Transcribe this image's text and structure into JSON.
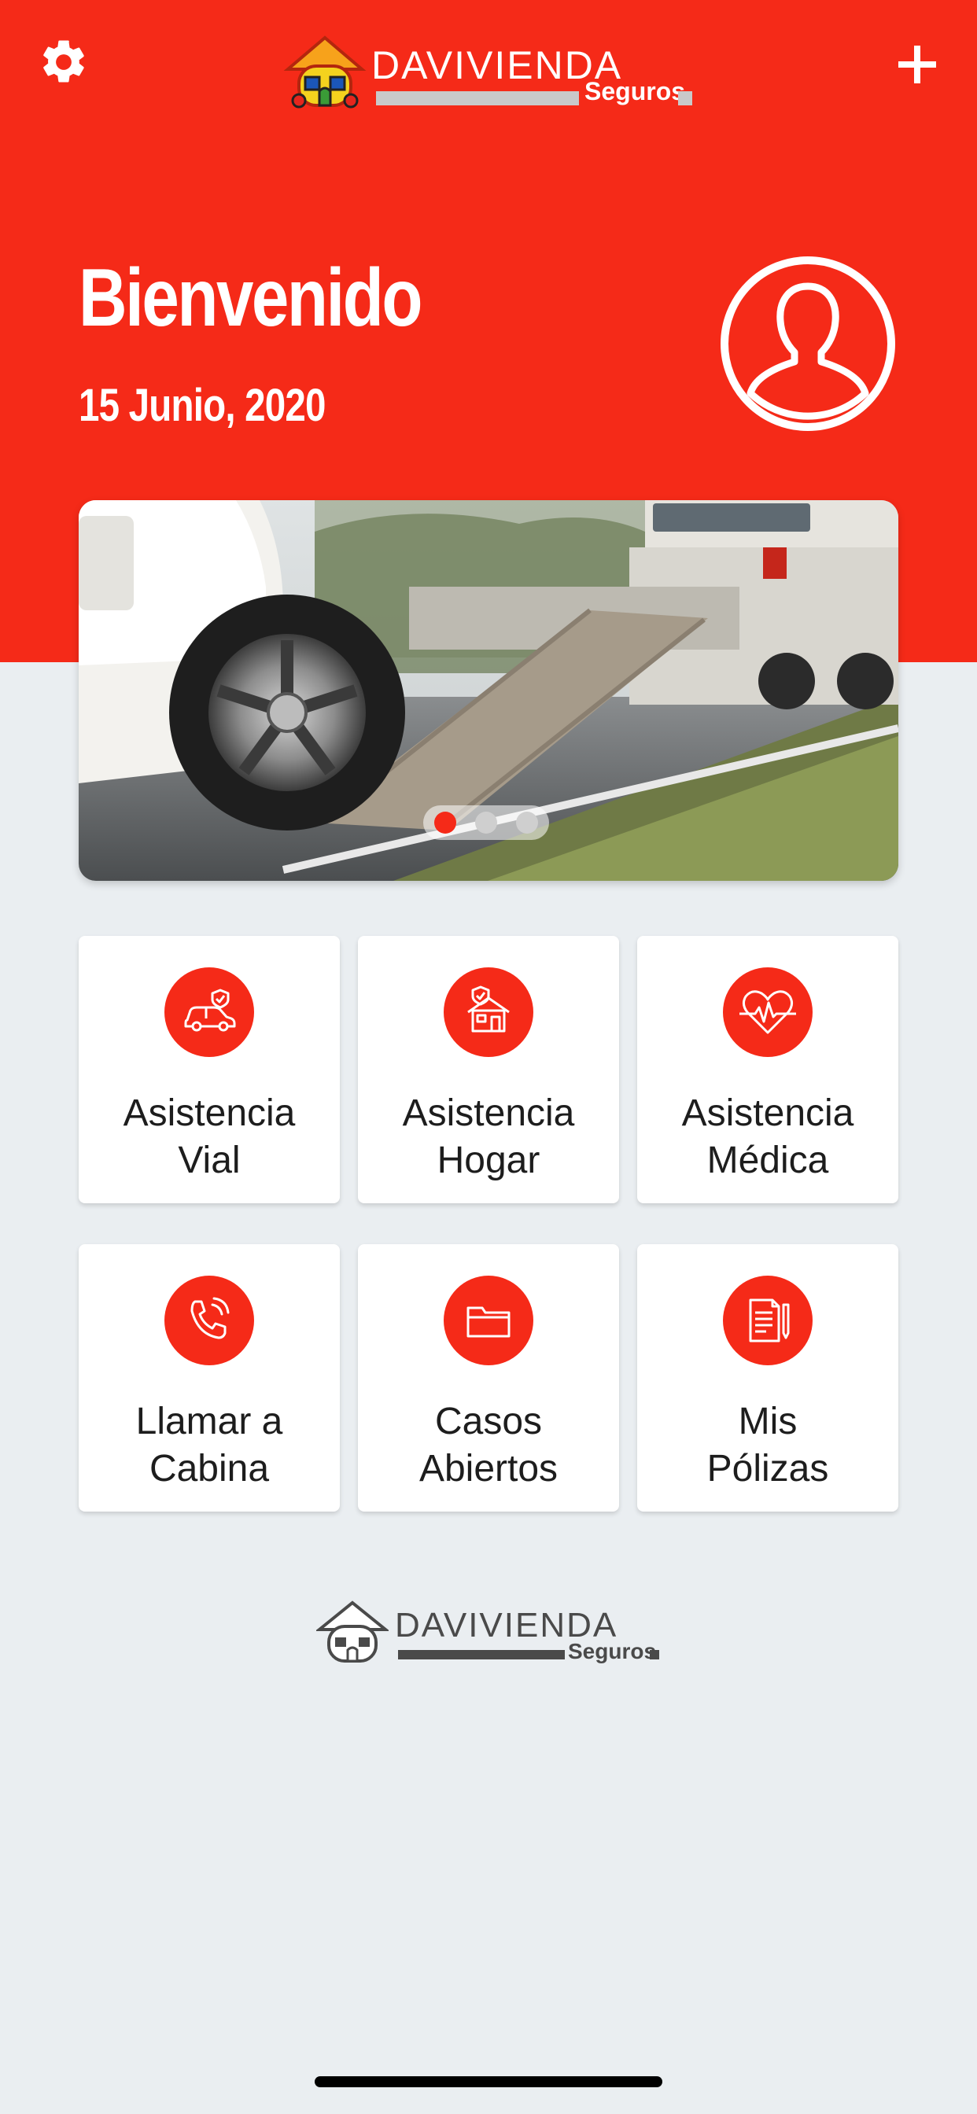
{
  "header": {
    "brand_name": "DAVIVIENDA",
    "brand_sub": "Seguros",
    "settings_icon": "gear-icon",
    "add_icon": "plus-icon",
    "accent_color": "#f52a18"
  },
  "welcome": {
    "title": "Bienvenido",
    "date": "15 Junio, 2020"
  },
  "banner": {
    "slide_count": 3,
    "active_slide": 1
  },
  "services": [
    {
      "line1": "Asistencia",
      "line2": "Vial",
      "icon": "car-shield-icon"
    },
    {
      "line1": "Asistencia",
      "line2": "Hogar",
      "icon": "house-shield-icon"
    },
    {
      "line1": "Asistencia",
      "line2": "Médica",
      "icon": "heartbeat-icon"
    },
    {
      "line1": "Llamar a",
      "line2": "Cabina",
      "icon": "phone-icon"
    },
    {
      "line1": "Casos",
      "line2": "Abiertos",
      "icon": "folder-icon"
    },
    {
      "line1": "Mis",
      "line2": "Pólizas",
      "icon": "policy-document-icon"
    }
  ],
  "footer": {
    "brand_name": "DAVIVIENDA",
    "brand_sub": "Seguros"
  }
}
